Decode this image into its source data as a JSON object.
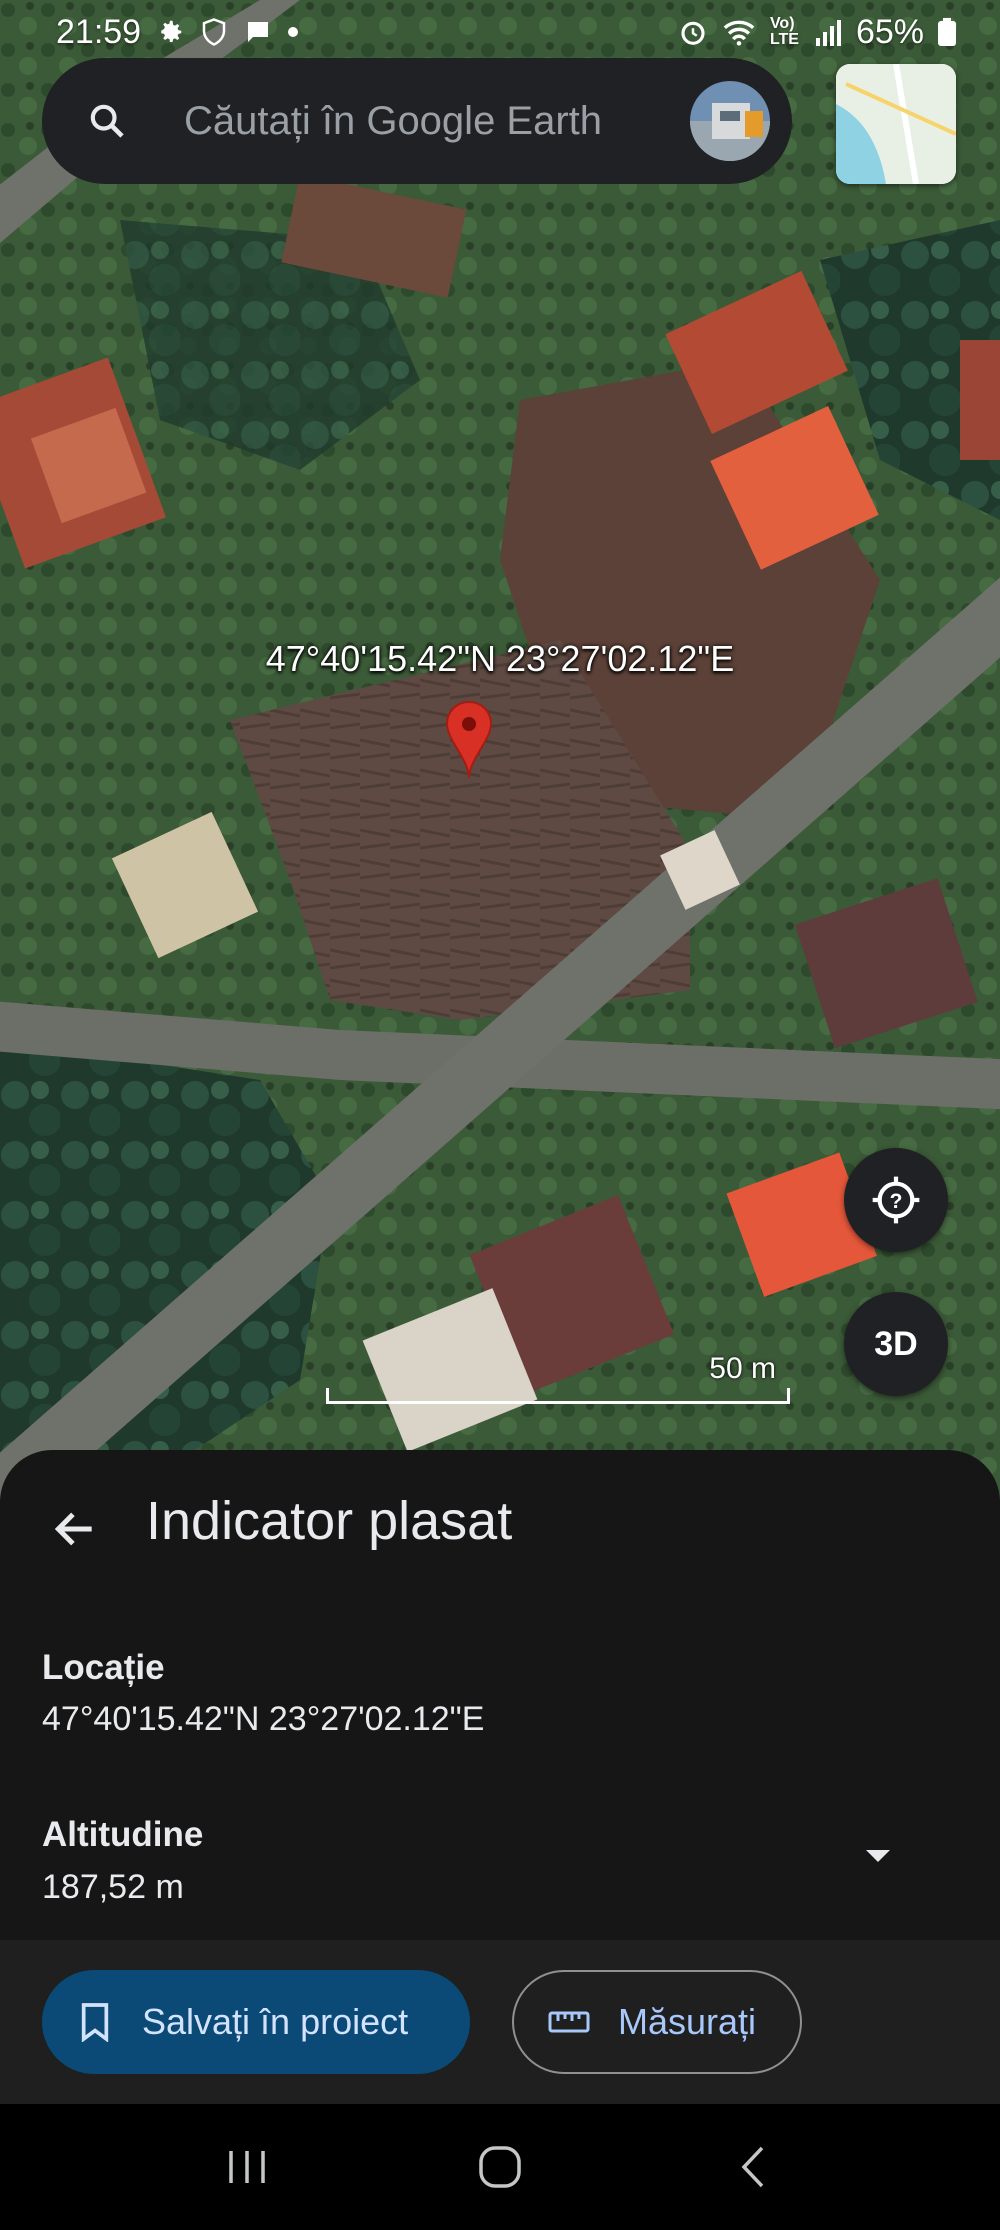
{
  "status_bar": {
    "time": "21:59",
    "battery": "65%",
    "network": "Vo) LTE"
  },
  "search": {
    "placeholder": "Căutați în Google Earth",
    "icon": "search-icon"
  },
  "map": {
    "pin_coordinates": "47°40'15.42\"N 23°27'02.12\"E",
    "scale_label": "50 m",
    "button_3d": "3D",
    "colors": {
      "pin": "#d93025",
      "save_button": "#0b4a76",
      "measure_text": "#a8c7fa"
    }
  },
  "sheet": {
    "title": "Indicator plasat",
    "location_label": "Locație",
    "location_value": "47°40'15.42\"N 23°27'02.12\"E",
    "altitude_label": "Altitudine",
    "altitude_value": "187,52 m"
  },
  "actions": {
    "save_label": "Salvați în proiect",
    "measure_label": "Măsurați"
  },
  "nav": {
    "recents": "recents-icon",
    "home": "home-icon",
    "back": "back-icon"
  }
}
